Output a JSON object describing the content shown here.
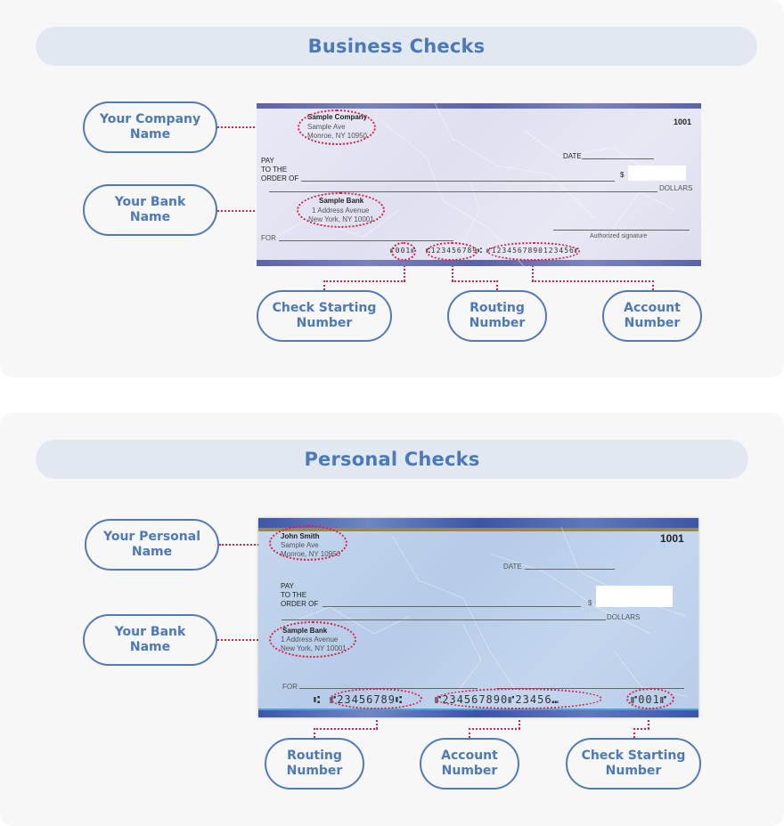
{
  "business": {
    "title": "Business Checks",
    "labels": {
      "company_name": [
        "Your Company",
        "Name"
      ],
      "bank_name": [
        "Your Bank",
        "Name"
      ],
      "check_starting_number": [
        "Check Starting",
        "Number"
      ],
      "routing_number": [
        "Routing",
        "Number"
      ],
      "account_number": [
        "Account",
        "Number"
      ]
    },
    "check": {
      "company": "Sample Company",
      "company_street": "Sample Ave",
      "company_city": "Monroe, NY 10950",
      "check_number": "1001",
      "date_label": "DATE",
      "pay_line1": "PAY",
      "pay_line2": "TO THE",
      "pay_line3": "ORDER OF",
      "dollar_sign": "$",
      "dollars_label": "DOLLARS",
      "bank": "Sample Bank",
      "bank_street": "1 Address Avenue",
      "bank_city": "New York, NY 10001",
      "for_label": "FOR",
      "signature_label": "Authorized signature",
      "micr_prefix": "⑈",
      "micr_check": "⑈001⑈",
      "micr_sep": "⑆",
      "micr_routing": "⑆123456789⑆",
      "micr_account": "⑈1234567890123456⑈"
    }
  },
  "personal": {
    "title": "Personal Checks",
    "labels": {
      "personal_name": [
        "Your Personal",
        "Name"
      ],
      "bank_name": [
        "Your Bank",
        "Name"
      ],
      "routing_number": [
        "Routing",
        "Number"
      ],
      "account_number": [
        "Account",
        "Number"
      ],
      "check_starting_number": [
        "Check Starting",
        "Number"
      ]
    },
    "check": {
      "name": "John Smith",
      "street": "Sample Ave",
      "city": "Monroe, NY 10950",
      "check_number": "1001",
      "date_label": "DATE",
      "pay_line1": "PAY",
      "pay_line2": "TO THE",
      "pay_line3": "ORDER OF",
      "dollar_sign": "$",
      "dollars_label": "DOLLARS",
      "bank": "Sample Bank",
      "bank_street": "1 Address Avenue",
      "bank_city": "New York, NY 10001",
      "for_label": "FOR",
      "micr_prefix": "⑆",
      "micr_routing": "⑈23456789⑆",
      "micr_account": "⑈234567890⑈23456⑉",
      "micr_check": "⑈001⑈"
    }
  },
  "colors": {
    "accent_blue": "#4c79b8",
    "callout_red": "#d9204a",
    "title_bg": "#e2e8f1",
    "panel_bg": "#f7f7f8"
  }
}
